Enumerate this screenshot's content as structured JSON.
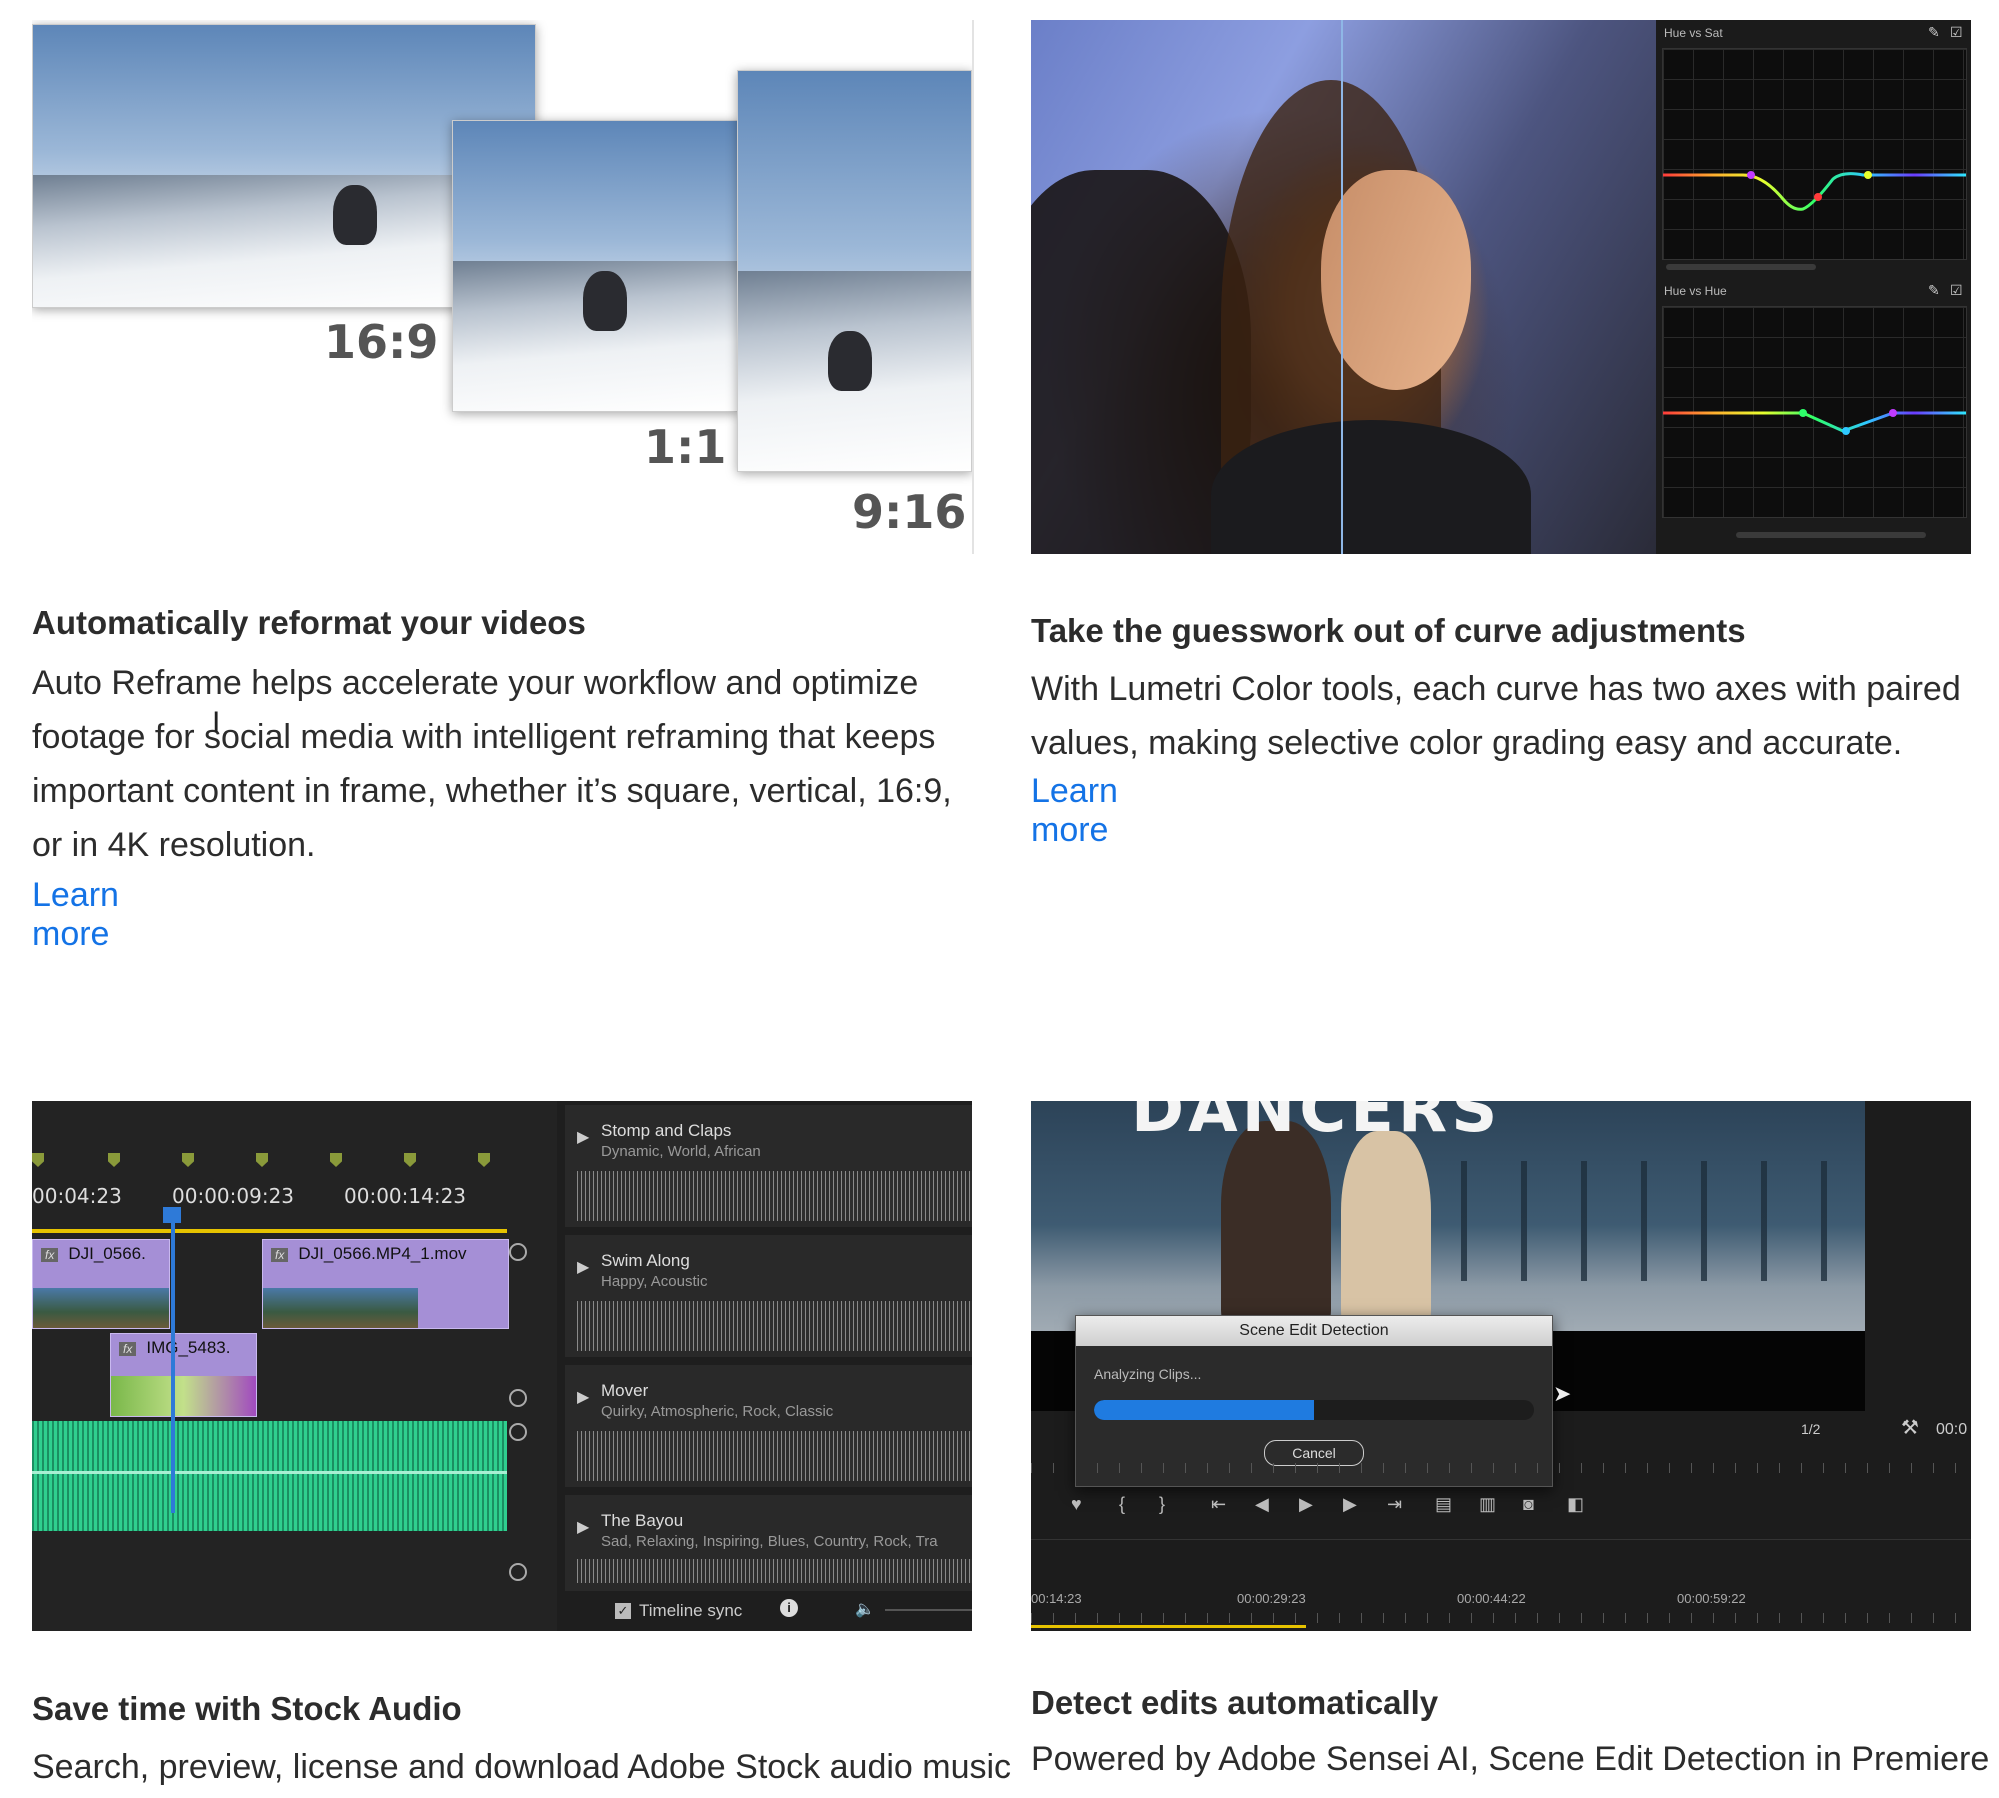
{
  "cards": [
    {
      "title": "Automatically reformat your videos",
      "body": "Auto Reframe helps accelerate your workflow and optimize footage for social media with intelligent reframing that keeps important content in frame, whether it’s square, vertical, 16:9, or in 4K resolution.",
      "link": "Learn more",
      "ratios": [
        "16:9",
        "1:1",
        "9:16"
      ]
    },
    {
      "title": "Take the guesswork out of curve adjustments",
      "body": "With Lumetri Color tools, each curve has two axes with paired values, making selective color grading easy and accurate.",
      "link": "Learn more",
      "curves": [
        "Hue vs Sat",
        "Hue vs Hue"
      ]
    },
    {
      "title": "Save time with Stock Audio",
      "body": "Search, preview, license and download Adobe Stock audio music",
      "timecodes": [
        "00:04:23",
        "00:00:09:23",
        "00:00:14:23"
      ],
      "clips": [
        "DJI_0566.",
        "DJI_0566.MP4_1.mov",
        "IMG_5483."
      ],
      "fx": "fx",
      "tracks": [
        {
          "name": "Stomp and Claps",
          "tags": "Dynamic, World, African"
        },
        {
          "name": "Swim Along",
          "tags": "Happy, Acoustic"
        },
        {
          "name": "Mover",
          "tags": "Quirky, Atmospheric, Rock, Classic"
        },
        {
          "name": "The Bayou",
          "tags": "Sad, Relaxing, Inspiring, Blues, Country, Rock, Tra"
        }
      ],
      "timeline_sync": "Timeline sync"
    },
    {
      "title": "Detect edits automatically",
      "body": "Powered by Adobe Sensei AI, Scene Edit Detection in Premiere",
      "video_title": "DANCERS",
      "dialog": {
        "title": "Scene Edit Detection",
        "status": "Analyzing Clips...",
        "progress": 0.5,
        "cancel": "Cancel"
      },
      "zoom": "1/2",
      "timecode_right": "00:0",
      "timecodes": [
        "00:14:23",
        "00:00:29:23",
        "00:00:44:22",
        "00:00:59:22"
      ]
    }
  ]
}
